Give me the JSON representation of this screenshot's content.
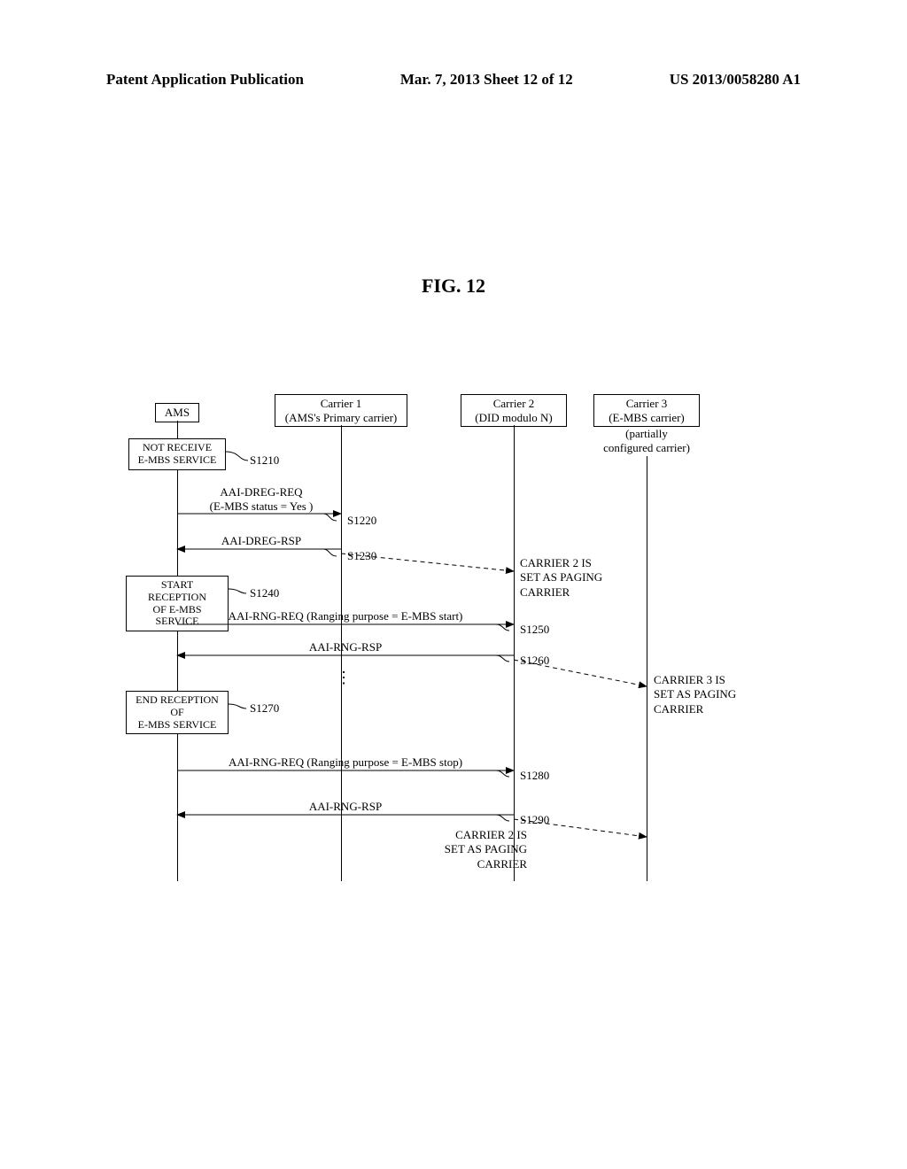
{
  "header": {
    "left": "Patent Application Publication",
    "center": "Mar. 7, 2013  Sheet 12 of 12",
    "right": "US 2013/0058280 A1"
  },
  "figure_title": "FIG. 12",
  "lanes": {
    "ams": {
      "label": "AMS"
    },
    "carrier1": {
      "label_line1": "Carrier 1",
      "label_line2": "(AMS's Primary carrier)"
    },
    "carrier2": {
      "label_line1": "Carrier 2",
      "label_line2": "(DID modulo N)"
    },
    "carrier3": {
      "label_line1": "Carrier 3",
      "label_line2": "(E-MBS carrier)",
      "sub_line1": "(partially",
      "sub_line2": "configured carrier)"
    }
  },
  "states": {
    "s1210_box": "NOT RECEIVE\nE-MBS SERVICE",
    "s1240_box": "START RECEPTION\nOF E-MBS SERVICE",
    "s1270_box": "END RECEPTION OF\nE-MBS SERVICE"
  },
  "steps": {
    "s1210": "S1210",
    "s1220": "S1220",
    "s1230": "S1230",
    "s1240": "S1240",
    "s1250": "S1250",
    "s1260": "S1260",
    "s1270": "S1270",
    "s1280": "S1280",
    "s1290": "S1290"
  },
  "messages": {
    "m1220_l1": "AAI-DREG-REQ",
    "m1220_l2": "(E-MBS status = Yes )",
    "m1230": "AAI-DREG-RSP",
    "m1250": "AAI-RNG-REQ (Ranging purpose = E-MBS start)",
    "m1260": "AAI-RNG-RSP",
    "m1280": "AAI-RNG-REQ (Ranging purpose = E-MBS stop)",
    "m1290": "AAI-RNG-RSP",
    "dots": "⋮"
  },
  "annotations": {
    "a1": "CARRIER 2 IS\nSET AS PAGING\nCARRIER",
    "a2": "CARRIER 3 IS\nSET AS PAGING\nCARRIER",
    "a3": "CARRIER 2 IS\nSET AS PAGING\nCARRIER"
  },
  "chart_data": {
    "type": "sequence-diagram",
    "participants": [
      {
        "id": "AMS",
        "label": "AMS"
      },
      {
        "id": "C1",
        "label": "Carrier 1 (AMS's Primary carrier)"
      },
      {
        "id": "C2",
        "label": "Carrier 2 (DID modulo N)"
      },
      {
        "id": "C3",
        "label": "Carrier 3 (E-MBS carrier) (partially configured carrier)"
      }
    ],
    "events": [
      {
        "step": "S1210",
        "kind": "state",
        "at": "AMS",
        "text": "NOT RECEIVE E-MBS SERVICE"
      },
      {
        "step": "S1220",
        "kind": "msg",
        "from": "AMS",
        "to": "C1",
        "text": "AAI-DREG-REQ (E-MBS status = Yes )"
      },
      {
        "step": "S1230",
        "kind": "msg",
        "from": "C1",
        "to": "AMS",
        "text": "AAI-DREG-RSP",
        "side_effect": {
          "target": "C2",
          "text": "CARRIER 2 IS SET AS PAGING CARRIER",
          "style": "dashed"
        }
      },
      {
        "step": "S1240",
        "kind": "state",
        "at": "AMS",
        "text": "START RECEPTION OF E-MBS SERVICE"
      },
      {
        "step": "S1250",
        "kind": "msg",
        "from": "AMS",
        "to": "C2",
        "text": "AAI-RNG-REQ (Ranging purpose = E-MBS start)"
      },
      {
        "step": "S1260",
        "kind": "msg",
        "from": "C2",
        "to": "AMS",
        "text": "AAI-RNG-RSP",
        "side_effect": {
          "target": "C3",
          "text": "CARRIER 3 IS SET AS PAGING CARRIER",
          "style": "dashed"
        }
      },
      {
        "step": "S1270",
        "kind": "state",
        "at": "AMS",
        "text": "END RECEPTION OF E-MBS SERVICE"
      },
      {
        "step": "S1280",
        "kind": "msg",
        "from": "AMS",
        "to": "C2",
        "text": "AAI-RNG-REQ (Ranging purpose = E-MBS stop)"
      },
      {
        "step": "S1290",
        "kind": "msg",
        "from": "C2",
        "to": "AMS",
        "text": "AAI-RNG-RSP",
        "side_effect": {
          "target_via": "C3",
          "text": "CARRIER 2 IS SET AS PAGING CARRIER",
          "style": "dashed"
        }
      }
    ]
  }
}
